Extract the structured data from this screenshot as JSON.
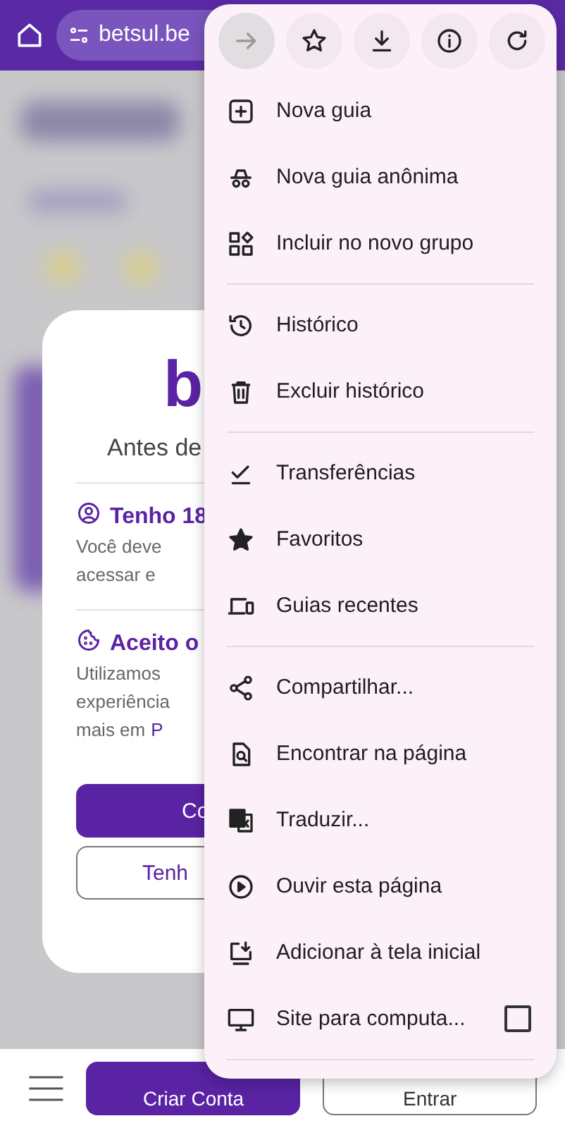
{
  "top_bar": {
    "url": "betsul.be"
  },
  "dialog": {
    "logo": "b",
    "title": "Antes de",
    "items": [
      {
        "kind": "person",
        "title": "Tenho 18",
        "lines": [
          "Você deve",
          "acessar e"
        ]
      },
      {
        "kind": "cookie",
        "title": "Aceito o",
        "lines": [
          "Utilizamos",
          "experiência",
          "mais em"
        ],
        "link": "P"
      }
    ],
    "buttons": [
      {
        "kind": "primary",
        "label": "Co"
      },
      {
        "kind": "outline",
        "label": "Tenh"
      }
    ]
  },
  "menu": {
    "toolbar": [
      {
        "disabled": true
      },
      {
        "disabled": false
      },
      {
        "disabled": false
      },
      {
        "disabled": false
      },
      {
        "disabled": false
      }
    ],
    "groups": [
      [
        {
          "kind": "action",
          "label": "Nova guia"
        },
        {
          "kind": "action",
          "label": "Nova guia anônima"
        },
        {
          "kind": "action",
          "label": "Incluir no novo grupo"
        }
      ],
      [
        {
          "kind": "action",
          "label": "Histórico"
        },
        {
          "kind": "action",
          "label": "Excluir histórico"
        }
      ],
      [
        {
          "kind": "action",
          "label": "Transferências"
        },
        {
          "kind": "action",
          "label": "Favoritos"
        },
        {
          "kind": "action",
          "label": "Guias recentes"
        }
      ],
      [
        {
          "kind": "action",
          "label": "Compartilhar..."
        },
        {
          "kind": "action",
          "label": "Encontrar na página"
        },
        {
          "kind": "action",
          "label": "Traduzir..."
        },
        {
          "kind": "action",
          "label": "Ouvir esta página"
        },
        {
          "kind": "action",
          "label": "Adicionar à tela inicial"
        },
        {
          "kind": "checkbox",
          "label": "Site para computa...",
          "checked": false
        }
      ]
    ]
  },
  "bottom_bar": {
    "buttons": [
      {
        "kind": "primary",
        "label": "Criar Conta"
      },
      {
        "kind": "outline",
        "label": "Entrar"
      }
    ]
  }
}
